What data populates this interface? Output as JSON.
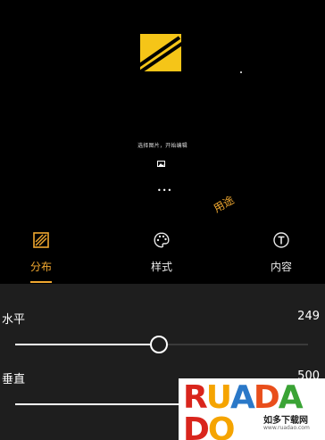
{
  "preview": {
    "hint": "选择图片，开始编辑",
    "watermark_text": "用途",
    "more_glyph": "•••"
  },
  "tabs": [
    {
      "label": "分布",
      "icon": "grid-pattern-icon",
      "active": true
    },
    {
      "label": "样式",
      "icon": "palette-icon",
      "active": false
    },
    {
      "label": "内容",
      "icon": "text-t-icon",
      "active": false
    }
  ],
  "controls": {
    "horizontal": {
      "label": "水平",
      "value": "249",
      "level": 0.49
    },
    "vertical": {
      "label": "垂直",
      "value": "500",
      "level": 1.0
    }
  },
  "ad": {
    "brand": "RUADADO",
    "tagline": "如多下载网",
    "url": "www.ruadao.com"
  },
  "colors": {
    "accent": "#f0a830",
    "background": "#000000",
    "panel": "#1e1e1e"
  }
}
